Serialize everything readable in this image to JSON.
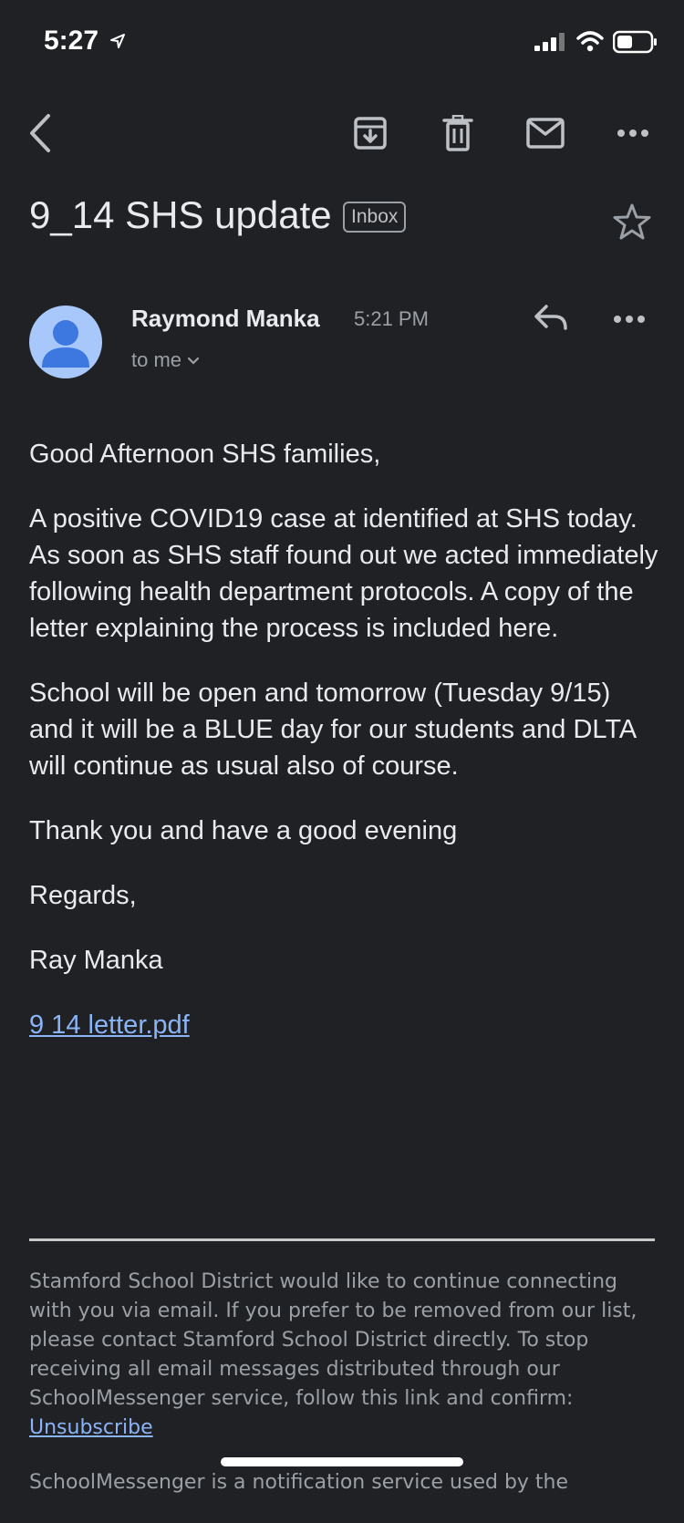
{
  "status_bar": {
    "time": "5:27"
  },
  "email": {
    "subject": "9_14 SHS update",
    "label": "Inbox",
    "sender": "Raymond Manka",
    "time": "5:21 PM",
    "recipient": "to me",
    "body": [
      "Good Afternoon SHS families,",
      "A positive COVID19 case at identified at SHS today.  As soon as SHS staff found out we acted immediately following health department protocols.  A copy of the letter explaining the process is included here.",
      "School will be open and tomorrow (Tuesday 9/15) and it will be a BLUE day for our students and DLTA will continue as usual also of course.",
      "Thank you and have a good evening",
      "Regards,",
      "Ray Manka"
    ],
    "attachment_link": "9 14 letter.pdf"
  },
  "footer": {
    "text": "Stamford School District would like to continue connecting with you via email. If you prefer to be removed from our list, please contact Stamford School District directly. To stop receiving all email messages distributed through our SchoolMessenger service, follow this link and confirm:",
    "unsubscribe_label": "Unsubscribe",
    "text2": "SchoolMessenger is a notification service used by the"
  },
  "icons": {
    "location": "location-arrow-icon",
    "signal": "cellular-signal-icon",
    "wifi": "wifi-icon",
    "battery": "battery-icon",
    "back": "back-arrow-icon",
    "archive": "archive-icon",
    "delete": "trash-icon",
    "mark_unread": "mail-icon",
    "more": "more-horizontal-icon",
    "star": "star-icon",
    "reply": "reply-icon",
    "expand": "chevron-down-icon"
  },
  "colors": {
    "background": "#202124",
    "text": "#e8eaed",
    "secondary_text": "#9aa0a6",
    "link": "#8ab4f8",
    "avatar": "#a8c7fa"
  }
}
